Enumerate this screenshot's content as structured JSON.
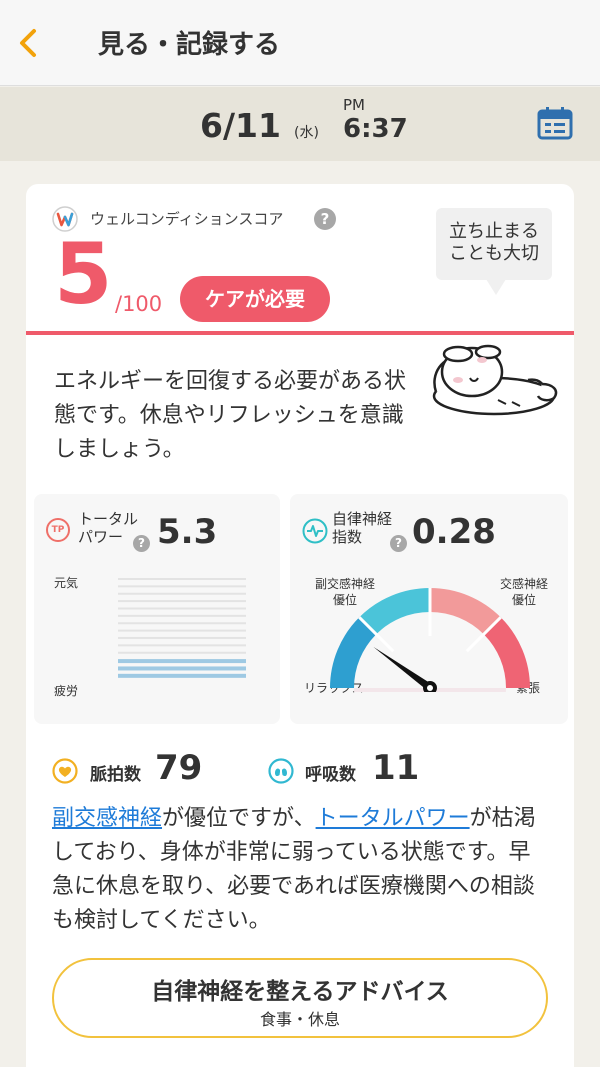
{
  "header": {
    "title": "見る・記録する"
  },
  "datebar": {
    "date": "6/11",
    "weekday": "(水)",
    "ampm": "PM",
    "time": "6:37"
  },
  "score": {
    "label": "ウェルコンディションスコア",
    "help": "?",
    "value": "5",
    "max": "/100",
    "status": "ケアが必要",
    "bubble_line1": "立ち止まる",
    "bubble_line2": "ことも大切",
    "description": "エネルギーを回復する必要がある状態です。休息やリフレッシュを意識しましょう。"
  },
  "total_power": {
    "icon": "TP",
    "label_line1": "トータル",
    "label_line2": "パワー",
    "help": "?",
    "value": "5.3",
    "top_label": "元気",
    "bottom_label": "疲労",
    "level_fraction": 0.21
  },
  "autonomic": {
    "label_line1": "自律神経",
    "label_line2": "指数",
    "help": "?",
    "value": "0.28",
    "parasym_line1": "副交感神経",
    "parasym_line2": "優位",
    "sym_line1": "交感神経",
    "sym_line2": "優位",
    "left_end": "リラックス",
    "right_end": "緊張",
    "needle_fraction": 0.2
  },
  "vitals": {
    "pulse_label": "脈拍数",
    "pulse_value": "79",
    "resp_label": "呼吸数",
    "resp_value": "11"
  },
  "advice_text": {
    "link1": "副交感神経",
    "text1": "が優位ですが、",
    "link2": "トータルパワー",
    "text2": "が枯渇しており、身体が非常に弱っている状態です。早急に休息を取り、必要であれば医療機関への相談も検討してください。"
  },
  "advice_button": {
    "title": "自律神経を整えるアドバイス",
    "subtitle": "食事・休息"
  },
  "colors": {
    "accent": "#ef5a6a",
    "nav_back": "#f2a20b",
    "link": "#1e7bd8",
    "parasympathetic": "#4bc4d9",
    "sympathetic": "#f07a84",
    "advice_border": "#f2c23d"
  }
}
